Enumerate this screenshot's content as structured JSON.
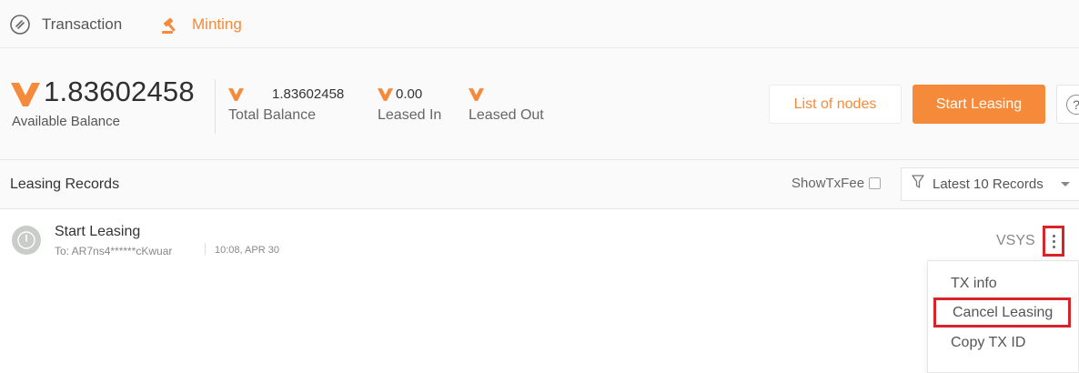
{
  "nav": {
    "tabs": [
      {
        "label": "Transaction",
        "icon": "transaction-icon",
        "active": false
      },
      {
        "label": "Minting",
        "icon": "gavel-icon",
        "active": true
      }
    ]
  },
  "balance": {
    "available_amount": "1.83602458",
    "available_label": "Available Balance",
    "total_value": "1.83602458",
    "total_label": "Total Balance",
    "leased_in_value": "0.00",
    "leased_in_label": "Leased In",
    "leased_out_label": "Leased Out",
    "logo_icon": "vsys-logo-icon"
  },
  "actions": {
    "list_nodes_label": "List of nodes",
    "start_leasing_label": "Start Leasing",
    "help_icon": "help-icon"
  },
  "records": {
    "title": "Leasing Records",
    "show_fee_label": "ShowTxFee",
    "show_fee_checked": false,
    "filter_label": "Latest 10 Records",
    "items": [
      {
        "title": "Start Leasing",
        "to": "To: AR7ns4******cKwuar",
        "time": "10:08, APR 30",
        "currency": "VSYS",
        "icon": "power-icon"
      }
    ]
  },
  "menu": {
    "items": [
      "TX info",
      "Cancel Leasing",
      "Copy TX ID"
    ]
  },
  "colors": {
    "accent": "#f58a3a",
    "highlight": "#d8232a",
    "icon_gray": "#c9ccc9"
  }
}
